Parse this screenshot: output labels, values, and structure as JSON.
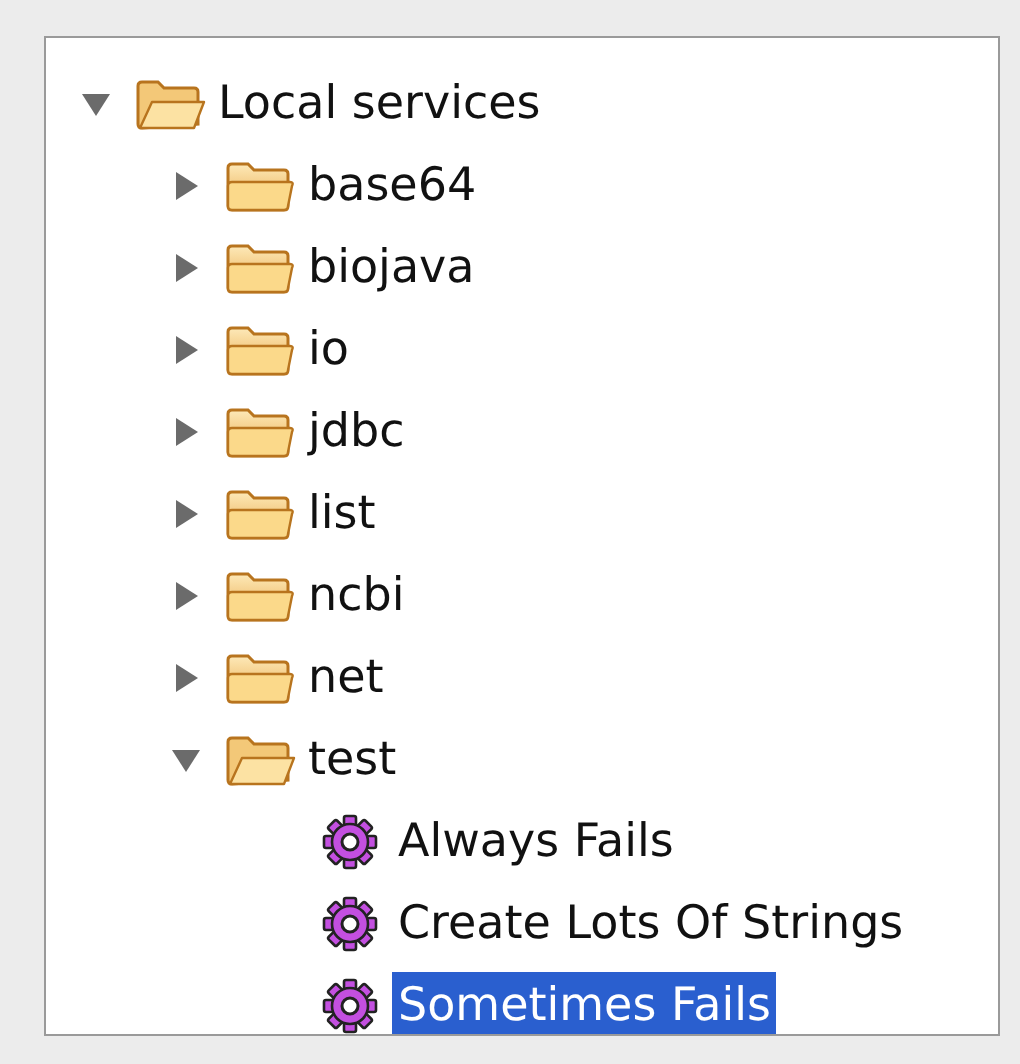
{
  "tree": [
    {
      "label": "Local services",
      "kind": "folder",
      "expanded": true,
      "selected": false,
      "children": [
        {
          "label": "base64",
          "kind": "folder",
          "expanded": false,
          "selected": false
        },
        {
          "label": "biojava",
          "kind": "folder",
          "expanded": false,
          "selected": false
        },
        {
          "label": "io",
          "kind": "folder",
          "expanded": false,
          "selected": false
        },
        {
          "label": "jdbc",
          "kind": "folder",
          "expanded": false,
          "selected": false
        },
        {
          "label": "list",
          "kind": "folder",
          "expanded": false,
          "selected": false
        },
        {
          "label": "ncbi",
          "kind": "folder",
          "expanded": false,
          "selected": false
        },
        {
          "label": "net",
          "kind": "folder",
          "expanded": false,
          "selected": false
        },
        {
          "label": "test",
          "kind": "folder",
          "expanded": true,
          "selected": false,
          "children": [
            {
              "label": "Always Fails",
              "kind": "service",
              "selected": false
            },
            {
              "label": "Create Lots Of Strings",
              "kind": "service",
              "selected": false
            },
            {
              "label": "Sometimes Fails",
              "kind": "service",
              "selected": true
            }
          ]
        }
      ]
    }
  ]
}
